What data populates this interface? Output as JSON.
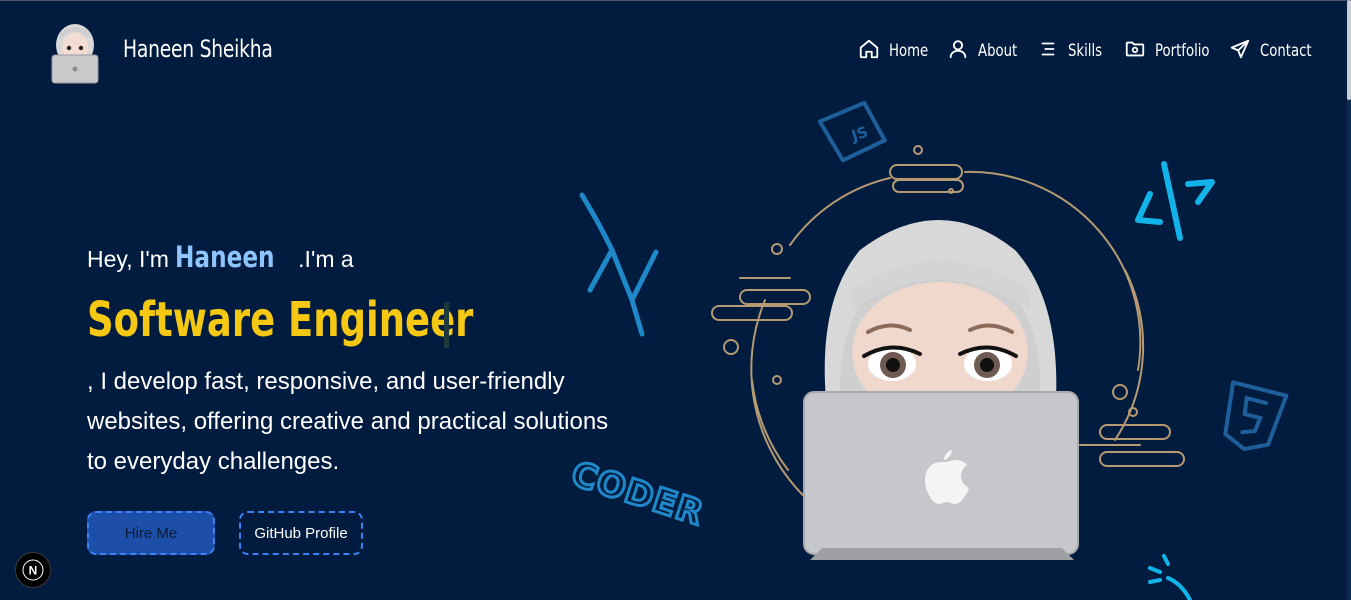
{
  "header": {
    "brand": "Haneen Sheikha",
    "nav": [
      {
        "label": "Home",
        "icon": "home-icon"
      },
      {
        "label": "About",
        "icon": "user-icon"
      },
      {
        "label": "Skills",
        "icon": "list-icon"
      },
      {
        "label": "Portfolio",
        "icon": "folder-icon"
      },
      {
        "label": "Contact",
        "icon": "send-icon"
      }
    ]
  },
  "hero": {
    "greeting_prefix": "Hey, I'm",
    "name": "Haneen",
    "greeting_suffix": ".I'm a",
    "role": "Software Engineer",
    "description": ", I develop fast, responsive, and user-friendly websites, offering creative and practical solutions to everyday challenges.",
    "hire_button": "Hire Me",
    "github_button": "GitHub Profile"
  },
  "decor": {
    "js_badge": "JS",
    "coder_sticker": "CODER",
    "next_badge": "N"
  },
  "colors": {
    "background": "#021c3f",
    "accent_yellow": "#f5c814",
    "accent_name": "#8ec5ff",
    "button_blue": "#1d4fa8",
    "doodle_blue": "#1e88c8"
  }
}
